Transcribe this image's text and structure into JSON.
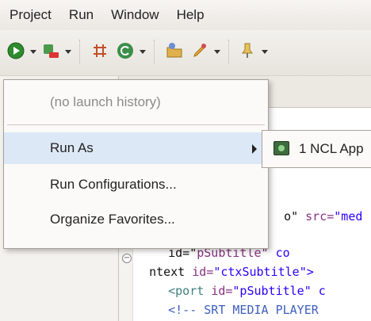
{
  "menubar": {
    "items": [
      "Project",
      "Run",
      "Window",
      "Help"
    ]
  },
  "toolbar": {
    "icons": [
      "run-icon",
      "debug-icon",
      "grid-icon",
      "refresh-icon",
      "open-type-icon",
      "edit-icon",
      "pin-icon"
    ]
  },
  "run_menu": {
    "no_history": "(no launch history)",
    "run_as": "Run As",
    "run_configurations": "Run Configurations...",
    "organize_favorites": "Organize Favorites..."
  },
  "submenu": {
    "item_label": "1 NCL App"
  },
  "editor": {
    "lines": [
      {
        "pre": "o\" ",
        "attr": "src=",
        "val": "\"med"
      },
      {
        "pre": "  id=\"",
        "attr": "pSubtitle\"",
        "val": " co"
      },
      {
        "pre": "ntext ",
        "attr": "id=",
        "val": "\"ctxSubtitle\">"
      },
      {
        "pre": "  <port ",
        "attr": "id=",
        "val": "\"pSubtitle\" c"
      },
      {
        "pre": "  <!-- ",
        "attr": "",
        "val": "SRT MEDIA PLAYER"
      }
    ]
  },
  "colors": {
    "menu_highlight": "#dde8f6",
    "disabled_text": "#8b8b8b"
  }
}
